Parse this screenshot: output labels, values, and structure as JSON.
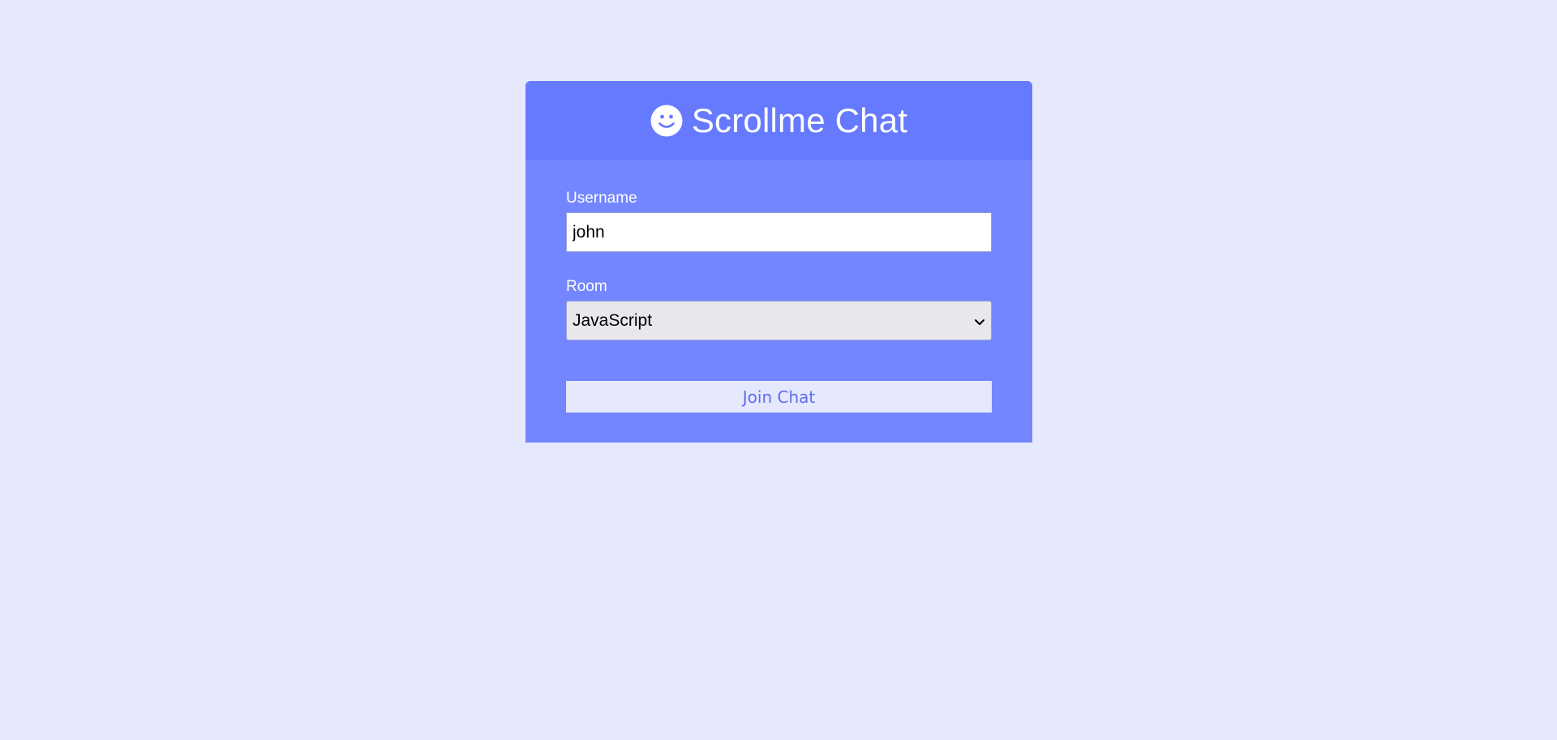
{
  "header": {
    "title": "Scrollme Chat",
    "logo_icon": "smile-icon"
  },
  "form": {
    "username_label": "Username",
    "username_value": "john",
    "room_label": "Room",
    "room_selected": "JavaScript",
    "join_label": "Join Chat"
  },
  "colors": {
    "page_background": "#e6e8fe",
    "header_background": "#667aff",
    "panel_background": "#7386ff",
    "button_text": "#5d6fee"
  }
}
